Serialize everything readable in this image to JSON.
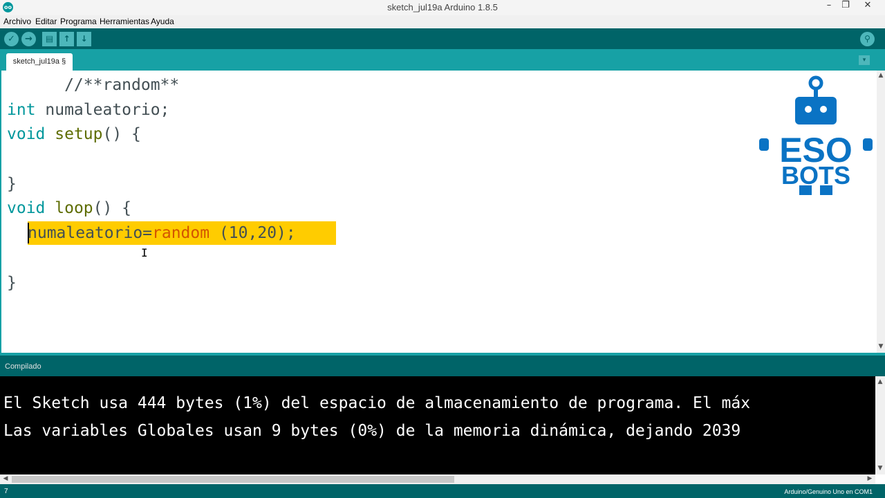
{
  "window": {
    "title": "sketch_jul19a Arduino 1.8.5",
    "app_icon": "oo",
    "min": "–",
    "restore": "❐",
    "close": "✕"
  },
  "menu": [
    "Archivo",
    "Editar",
    "Programa",
    "Herramientas",
    "Ayuda"
  ],
  "toolbar": {
    "verify": "✓",
    "upload": "→",
    "new": "▤",
    "open": "↑",
    "save": "↓",
    "serial_monitor": "⚲"
  },
  "tab": {
    "label": "sketch_jul19a §",
    "menu": "▾"
  },
  "code": {
    "line1": "      //**random**",
    "line2_kw": "int",
    "line2_rest": " numaleatorio;",
    "line3_kw": "void",
    "line3_fn": "setup",
    "line3_rest": "() {",
    "line5": "}",
    "line6_kw": "void",
    "line6_fn": "loop",
    "line6_rest": "() {",
    "line7_var": "numaleatorio=",
    "line7_fn": "random",
    "line7_rest": " (10,20);",
    "line9": "}"
  },
  "logo": {
    "line1": "ESO",
    "line2": "BOTS"
  },
  "status": {
    "text": "Compilado"
  },
  "console": {
    "line1": "El Sketch usa 444 bytes (1%) del espacio de almacenamiento de programa. El máx",
    "line2": "Las variables Globales usan 9 bytes (0%) de la memoria dinámica, dejando 2039"
  },
  "footer": {
    "line_number": "7",
    "board": "Arduino/Genuino Uno en COM1"
  },
  "colors": {
    "toolbar": "#006468",
    "tabstrip": "#17a1a5",
    "selection": "#ffcc00",
    "keyword": "#00979c",
    "function": "#5e6d03",
    "logo_blue": "#0a73c4"
  }
}
